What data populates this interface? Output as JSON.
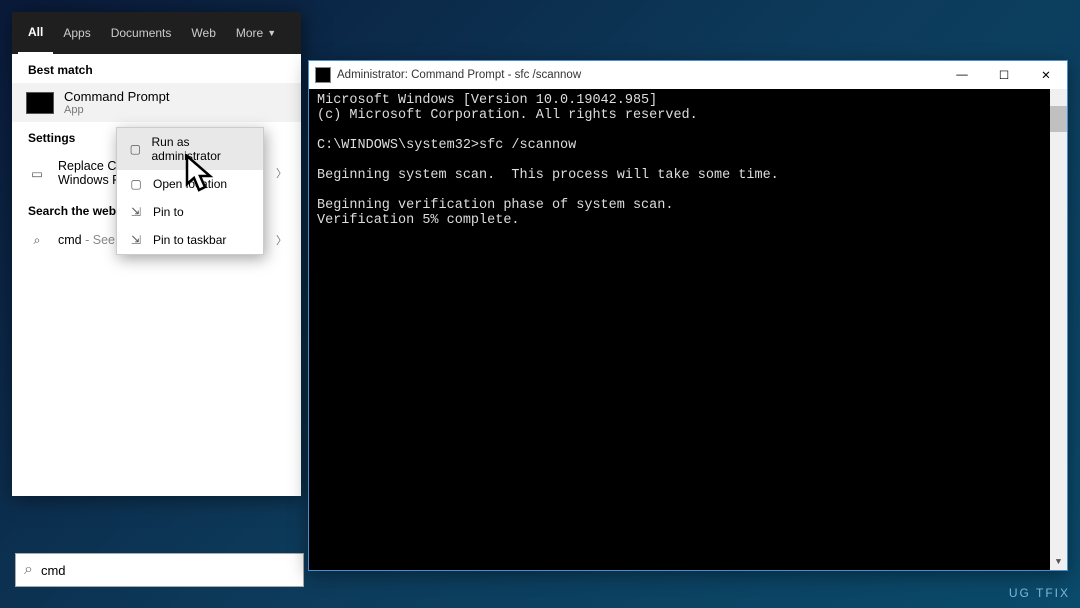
{
  "tabs": {
    "all": "All",
    "apps": "Apps",
    "docs": "Documents",
    "web": "Web",
    "more": "More"
  },
  "sections": {
    "best": "Best match",
    "settings": "Settings",
    "searchweb": "Search the web"
  },
  "match": {
    "title": "Command Prompt",
    "sub": "App"
  },
  "settings_row": {
    "line1": "Replace Co",
    "line2": "Windows P"
  },
  "web_row": {
    "term": "cmd",
    "sub": " - See web results"
  },
  "ctx": {
    "run": "Run as administrator",
    "open": "Open            location",
    "pinstart": "Pin to ",
    "pintask": "Pin to taskbar"
  },
  "searchbox": {
    "value": "cmd"
  },
  "cmdwin": {
    "title": "Administrator: Command Prompt - sfc  /scannow",
    "line1": "Microsoft Windows [Version 10.0.19042.985]",
    "line2": "(c) Microsoft Corporation. All rights reserved.",
    "prompt": "C:\\WINDOWS\\system32>sfc /scannow",
    "scan1": "Beginning system scan.  This process will take some time.",
    "scan2": "Beginning verification phase of system scan.",
    "scan3": "Verification 5% complete."
  },
  "watermark": "UG   TFIX"
}
